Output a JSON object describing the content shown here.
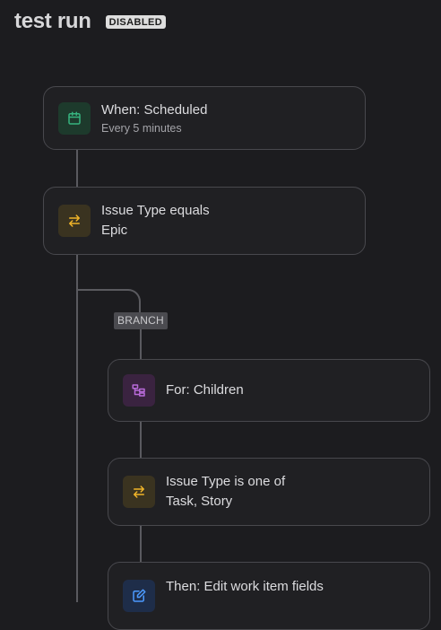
{
  "header": {
    "title": "test run",
    "status": "DISABLED"
  },
  "branch_label": "BRANCH",
  "nodes": {
    "trigger": {
      "title": "When: Scheduled",
      "subtitle": "Every 5 minutes",
      "icon": "calendar-icon",
      "color": "#36b37e"
    },
    "condition1": {
      "title": "Issue Type equals",
      "value": "Epic",
      "icon": "swap-arrows-icon",
      "color": "#f0b429"
    },
    "branch_for": {
      "title": "For: Children",
      "icon": "hierarchy-icon",
      "color": "#b86ad9"
    },
    "condition2": {
      "title": "Issue Type is one of",
      "value": "Task, Story",
      "icon": "swap-arrows-icon",
      "color": "#f0b429"
    },
    "action": {
      "title": "Then: Edit work item fields",
      "icon": "edit-icon",
      "color": "#4c9aff"
    }
  }
}
